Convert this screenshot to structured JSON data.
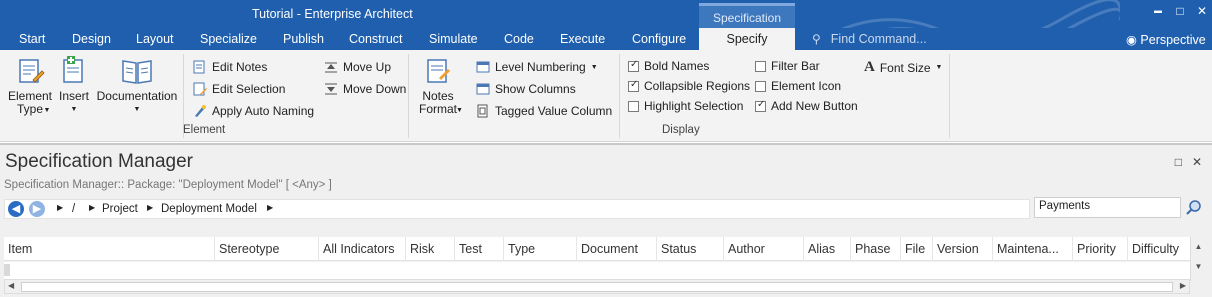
{
  "window": {
    "title": "Tutorial - Enterprise Architect",
    "context_tab_header": "Specification",
    "controls": {
      "minimize": "▬",
      "maximize": "□",
      "close": "✕"
    }
  },
  "tabs": [
    "Start",
    "Design",
    "Layout",
    "Specialize",
    "Publish",
    "Construct",
    "Simulate",
    "Code",
    "Execute",
    "Configure",
    "Specify"
  ],
  "active_tab": "Specify",
  "find_command": {
    "placeholder": "Find Command..."
  },
  "perspective": {
    "label": "Perspective"
  },
  "ribbon": {
    "element_group": {
      "label": "Element",
      "element_type": "Element\nType",
      "insert": "Insert",
      "documentation": "Documentation",
      "edit_notes": "Edit Notes",
      "edit_selection": "Edit Selection",
      "apply_auto_naming": "Apply Auto Naming",
      "move_up": "Move Up",
      "move_down": "Move Down"
    },
    "display_group": {
      "label": "Display",
      "notes_format": "Notes\nFormat",
      "level_numbering": "Level Numbering",
      "show_columns": "Show Columns",
      "tagged_value_column": "Tagged Value Column",
      "bold_names": {
        "label": "Bold Names",
        "checked": true
      },
      "collapsible_regions": {
        "label": "Collapsible Regions",
        "checked": true
      },
      "highlight_selection": {
        "label": "Highlight Selection",
        "checked": false
      },
      "filter_bar": {
        "label": "Filter Bar",
        "checked": false
      },
      "element_icon": {
        "label": "Element Icon",
        "checked": false
      },
      "add_new_button": {
        "label": "Add New Button",
        "checked": true
      },
      "font_size": "Font Size"
    }
  },
  "panel": {
    "title": "Specification Manager",
    "subtitle": "Specification Manager::  Package: \"Deployment Model\"  [ <Any> ]",
    "breadcrumb": [
      "/",
      "Project",
      "Deployment Model"
    ],
    "search_value": "Payments",
    "columns": [
      "Item",
      "Stereotype",
      "All Indicators",
      "Risk",
      "Test",
      "Type",
      "Document",
      "Status",
      "Author",
      "Alias",
      "Phase",
      "File",
      "Version",
      "Maintena...",
      "Priority",
      "Difficulty"
    ]
  }
}
